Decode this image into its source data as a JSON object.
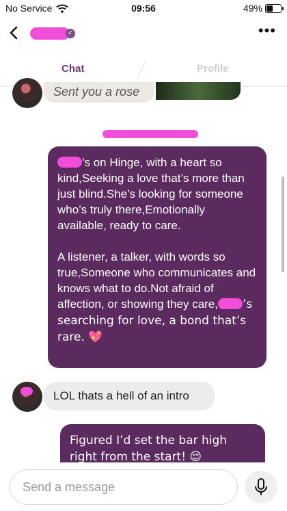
{
  "status_bar": {
    "carrier": "No Service",
    "time": "09:56",
    "battery": "49%",
    "battery_level": 0.49
  },
  "header": {
    "back_icon": "chevron-left-icon",
    "more_icon": "more-dots-icon",
    "verified_icon": "verified-badge-icon"
  },
  "tabs": [
    {
      "label": "Chat",
      "active": true
    },
    {
      "label": "Profile",
      "active": false
    }
  ],
  "messages": {
    "rose": "Sent you a rose",
    "poem_part1": "’s on Hinge, with a heart so kind,Seeking a love that’s more than just blind.She’s looking for someone who’s truly there,Emotionally available, ready to care.",
    "poem_part2_a": "A listener, a talker, with words so true,Someone who communicates and knows what to do.Not afraid of affection, or showing they care,",
    "poem_part2_b": "’s searching for love, a bond that’s rare. 💖",
    "reply": "LOL thats a hell of an intro",
    "last": "Figured I’d set the bar high right from the start! 😌"
  },
  "composer": {
    "placeholder": "Send a message",
    "mic_icon": "microphone-icon"
  },
  "colors": {
    "accent": "#6d3a74",
    "sent_bubble": "#5b2a5e",
    "received_bubble": "#ececec",
    "redaction": "#f04ed8"
  }
}
